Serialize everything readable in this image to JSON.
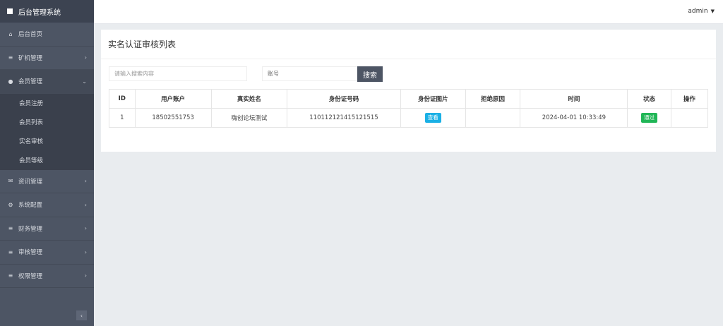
{
  "app": {
    "title": "后台管理系统"
  },
  "sidebar": {
    "items": [
      {
        "label": "后台首页",
        "icon": "home-icon"
      },
      {
        "label": "矿机管理",
        "icon": "list-icon"
      },
      {
        "label": "会员管理",
        "icon": "user-icon"
      },
      {
        "label": "资讯管理",
        "icon": "envelope-icon"
      },
      {
        "label": "系统配置",
        "icon": "cogs-icon"
      },
      {
        "label": "财务管理",
        "icon": "list-icon"
      },
      {
        "label": "审核管理",
        "icon": "list-icon"
      },
      {
        "label": "权限管理",
        "icon": "list-icon"
      }
    ],
    "member_sub": [
      {
        "label": "会员注册"
      },
      {
        "label": "会员列表"
      },
      {
        "label": "实名审核"
      },
      {
        "label": "会员等级"
      }
    ]
  },
  "topbar": {
    "user": "admin"
  },
  "page": {
    "title": "实名认证审核列表",
    "search_placeholder": "请输入搜索内容",
    "account_placeholder": "账号",
    "search_button": "搜索"
  },
  "table": {
    "headers": [
      "ID",
      "用户账户",
      "真实姓名",
      "身份证号码",
      "身份证图片",
      "拒绝原因",
      "时间",
      "状态",
      "操作"
    ],
    "rows": [
      {
        "id": "1",
        "account": "18502551753",
        "name": "嗨创论坛测试",
        "idcard": "110112121415121515",
        "image_button": "查看",
        "reason": "",
        "time": "2024-04-01 10:33:49",
        "status": "通过",
        "action": ""
      }
    ]
  },
  "colors": {
    "sidebar_bg": "#4d5564",
    "view_badge": "#1ab0e5",
    "pass_badge": "#21b657"
  }
}
